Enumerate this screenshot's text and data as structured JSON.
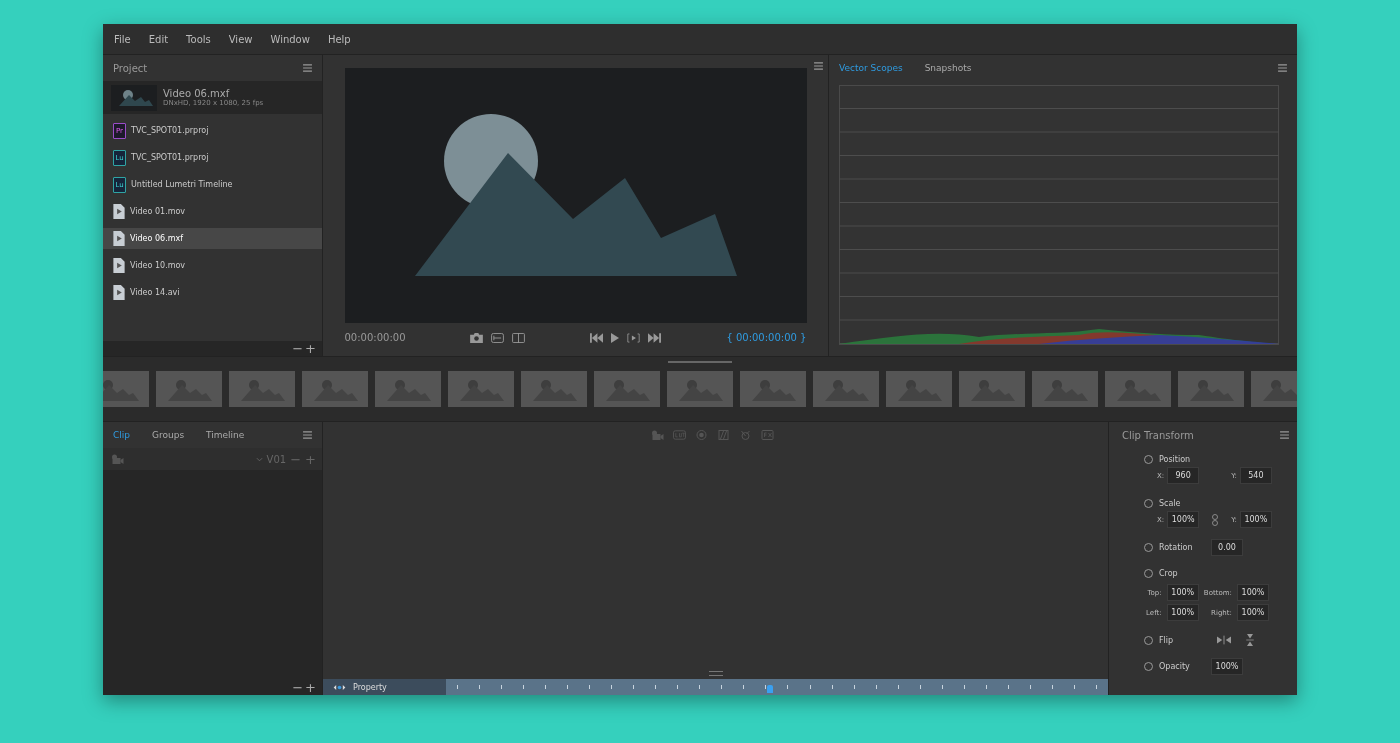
{
  "menu": [
    "File",
    "Edit",
    "Tools",
    "View",
    "Window",
    "Help"
  ],
  "project": {
    "title": "Project",
    "preview": {
      "name": "Video 06.mxf",
      "info": "DNxHD, 1920 x 1080, 25 fps"
    },
    "files": [
      {
        "name": "TVC_SPOT01.prproj",
        "kind": "pr",
        "badge": "Pr",
        "selected": false
      },
      {
        "name": "TVC_SPOT01.prproj",
        "kind": "lu",
        "badge": "Lu",
        "selected": false
      },
      {
        "name": "Untitled Lumetri Timeline",
        "kind": "lu",
        "badge": "Lu",
        "selected": false
      },
      {
        "name": "Video 01.mov",
        "kind": "video",
        "selected": false
      },
      {
        "name": "Video 06.mxf",
        "kind": "video",
        "selected": true
      },
      {
        "name": "Video 10.mov",
        "kind": "video",
        "selected": false
      },
      {
        "name": "Video 14.avi",
        "kind": "video",
        "selected": false
      }
    ],
    "footer_buttons": [
      "−",
      "+"
    ]
  },
  "viewer": {
    "timecode": "00:00:00:00",
    "duration": "{ 00:00:00:00 }"
  },
  "scopes": {
    "tabs": [
      {
        "label": "Vector Scopes",
        "selected": true
      },
      {
        "label": "Snapshots",
        "selected": false
      }
    ]
  },
  "clip_panel": {
    "tabs": [
      {
        "label": "Clip",
        "selected": true
      },
      {
        "label": "Groups",
        "selected": false
      },
      {
        "label": "Timeline",
        "selected": false
      }
    ],
    "track": "V01",
    "track_buttons": [
      "−",
      "+"
    ],
    "footer_buttons": [
      "−",
      "+"
    ]
  },
  "timeline": {
    "label": "Property",
    "playhead": {
      "level": 0.49
    }
  },
  "transform": {
    "title": "Clip Transform",
    "properties": [
      {
        "label": "Position",
        "kind": "pair",
        "checked": false,
        "fields": [
          {
            "label": "X:",
            "value": "960"
          },
          {
            "label": "Y:",
            "value": "540"
          }
        ]
      },
      {
        "label": "Scale",
        "kind": "linked",
        "checked": false,
        "fields": [
          {
            "label": "X:",
            "value": "100%"
          },
          {
            "label": "Y:",
            "value": "100%"
          }
        ]
      },
      {
        "label": "Rotation",
        "kind": "single",
        "checked": false,
        "value": "0.00"
      },
      {
        "label": "Crop",
        "kind": "grid",
        "checked": false,
        "fields": [
          {
            "label": "Top:",
            "value": "100%"
          },
          {
            "label": "Bottom:",
            "value": "100%"
          },
          {
            "label": "Left:",
            "value": "100%"
          },
          {
            "label": "Right:",
            "value": "100%"
          }
        ]
      },
      {
        "label": "Flip",
        "kind": "flip",
        "checked": false
      },
      {
        "label": "Opacity",
        "kind": "single",
        "checked": false,
        "value": "100%"
      }
    ]
  }
}
